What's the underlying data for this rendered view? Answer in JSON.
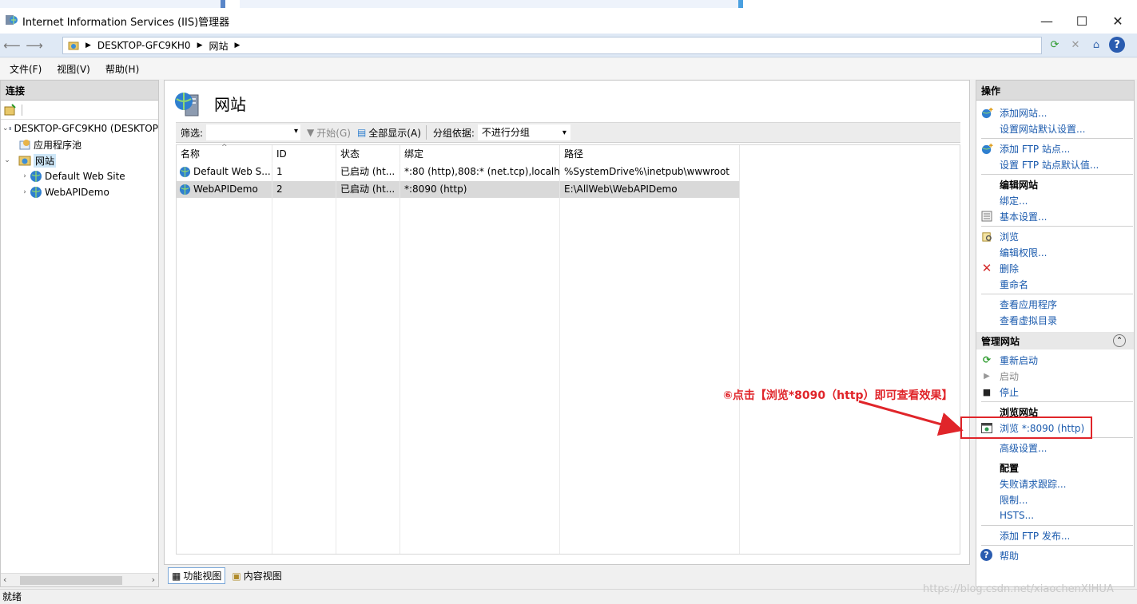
{
  "window": {
    "title": "Internet Information Services (IIS)管理器",
    "minimize": "—",
    "maximize": "☐",
    "close": "✕"
  },
  "address": {
    "crumbs": [
      "DESKTOP-GFC9KH0",
      "网站"
    ]
  },
  "menu": [
    "文件(F)",
    "视图(V)",
    "帮助(H)"
  ],
  "connections": {
    "header": "连接",
    "tree": [
      {
        "label": "DESKTOP-GFC9KH0 (DESKTOP",
        "level": 0
      },
      {
        "label": "应用程序池",
        "level": 1
      },
      {
        "label": "网站",
        "level": 1,
        "selected": true
      },
      {
        "label": "Default Web Site",
        "level": 2
      },
      {
        "label": "WebAPIDemo",
        "level": 2
      }
    ]
  },
  "center": {
    "title": "网站",
    "filter_label": "筛选:",
    "start_label": "开始(G)",
    "show_all_label": "全部显示(A)",
    "group_by_label": "分组依据:",
    "group_by_value": "不进行分组",
    "columns": [
      "名称",
      "ID",
      "状态",
      "绑定",
      "路径"
    ],
    "rows": [
      [
        "Default Web S...",
        "1",
        "已启动 (ht...",
        "*:80 (http),808:* (net.tcp),localh...",
        "%SystemDrive%\\inetpub\\wwwroot"
      ],
      [
        "WebAPIDemo",
        "2",
        "已启动 (ht...",
        "*:8090 (http)",
        "E:\\AllWeb\\WebAPIDemo"
      ]
    ],
    "selected_row": 1,
    "tabs": [
      "功能视图",
      "内容视图"
    ]
  },
  "actions": {
    "header": "操作",
    "items": {
      "add_site": "添加网站...",
      "site_defaults": "设置网站默认设置...",
      "add_ftp": "添加 FTP 站点...",
      "ftp_defaults": "设置 FTP 站点默认值...",
      "edit_site_section": "编辑网站",
      "bindings": "绑定...",
      "basic_settings": "基本设置...",
      "browse": "浏览",
      "edit_permissions": "编辑权限...",
      "delete": "删除",
      "rename": "重命名",
      "view_apps": "查看应用程序",
      "view_vdirs": "查看虚拟目录",
      "manage_site_head": "管理网站",
      "restart": "重新启动",
      "start": "启动",
      "stop": "停止",
      "browse_site_section": "浏览网站",
      "browse_8090": "浏览 *:8090 (http)",
      "advanced_settings": "高级设置...",
      "config_section": "配置",
      "failed_tracing": "失败请求跟踪...",
      "limits": "限制...",
      "hsts": "HSTS...",
      "add_ftp_publish": "添加 FTP 发布...",
      "help": "帮助"
    }
  },
  "annotation": {
    "text": "⑥点击【浏览*8090（http）即可查看效果】",
    "color": "#e0252a"
  },
  "status": {
    "text": "就绪"
  },
  "watermark": "https://blog.csdn.net/xiaochenXIHUA"
}
